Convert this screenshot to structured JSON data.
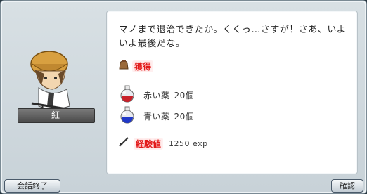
{
  "npc": {
    "name": "紅"
  },
  "dialog": {
    "text": "マノまで退治できたか。くくっ…さすが！さあ、いよいよ最後だな。"
  },
  "rewards": {
    "obtain_label": "獲得",
    "items": [
      {
        "name": "赤い薬",
        "count": "20個",
        "icon": "red-potion-icon",
        "color": "#c8202a"
      },
      {
        "name": "青い薬",
        "count": "20個",
        "icon": "blue-potion-icon",
        "color": "#2038c8"
      }
    ],
    "exp_label": "経験値",
    "exp_value": "1250 exp"
  },
  "buttons": {
    "end_conversation": "会話終了",
    "confirm": "確認"
  }
}
